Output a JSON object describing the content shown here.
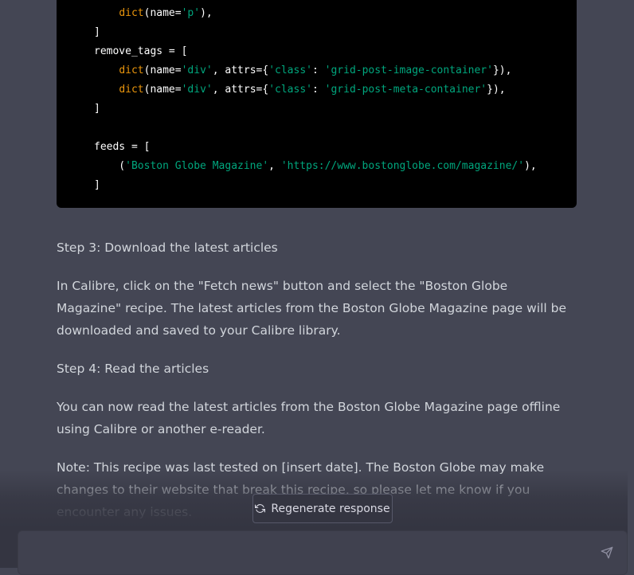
{
  "code": {
    "lines": [
      [
        {
          "t": "    "
        },
        {
          "t": "dict",
          "c": "kw"
        },
        {
          "t": "(name="
        },
        {
          "t": "'p'",
          "c": "str"
        },
        {
          "t": "),"
        }
      ],
      [
        {
          "t": "]"
        }
      ],
      [
        {
          "t": "remove_tags = ["
        }
      ],
      [
        {
          "t": "    "
        },
        {
          "t": "dict",
          "c": "kw"
        },
        {
          "t": "(name="
        },
        {
          "t": "'div'",
          "c": "str"
        },
        {
          "t": ", attrs={"
        },
        {
          "t": "'class'",
          "c": "str"
        },
        {
          "t": ": "
        },
        {
          "t": "'grid-post-image-container'",
          "c": "str"
        },
        {
          "t": "}),"
        }
      ],
      [
        {
          "t": "    "
        },
        {
          "t": "dict",
          "c": "kw"
        },
        {
          "t": "(name="
        },
        {
          "t": "'div'",
          "c": "str"
        },
        {
          "t": ", attrs={"
        },
        {
          "t": "'class'",
          "c": "str"
        },
        {
          "t": ": "
        },
        {
          "t": "'grid-post-meta-container'",
          "c": "str"
        },
        {
          "t": "}),"
        }
      ],
      [
        {
          "t": "]"
        }
      ],
      [
        {
          "t": ""
        }
      ],
      [
        {
          "t": "feeds = ["
        }
      ],
      [
        {
          "t": "    ("
        },
        {
          "t": "'Boston Globe Magazine'",
          "c": "str"
        },
        {
          "t": ", "
        },
        {
          "t": "'https://www.bostonglobe.com/magazine/'",
          "c": "str"
        },
        {
          "t": "),"
        }
      ],
      [
        {
          "t": "]"
        }
      ]
    ]
  },
  "response": {
    "step3_heading": "Step 3: Download the latest articles",
    "step3_body": "In Calibre, click on the \"Fetch news\" button and select the \"Boston Globe Magazine\" recipe. The latest articles from the Boston Globe Magazine page will be downloaded and saved to your Calibre library.",
    "step4_heading": "Step 4: Read the articles",
    "step4_body": "You can now read the latest articles from the Boston Globe Magazine page offline using Calibre or another e-reader.",
    "note": "Note: This recipe was last tested on [insert date]. The Boston Globe may make changes to their website that break this recipe, so please let me know if you encounter any issues."
  },
  "regenerate": {
    "label": "Regenerate response",
    "icon": "refresh-icon"
  },
  "composer": {
    "value": "",
    "placeholder": "",
    "send_icon": "send-icon"
  },
  "colors": {
    "keyword": "#e9950c",
    "string": "#00a67d",
    "background": "#444654",
    "code_bg": "#000000"
  }
}
